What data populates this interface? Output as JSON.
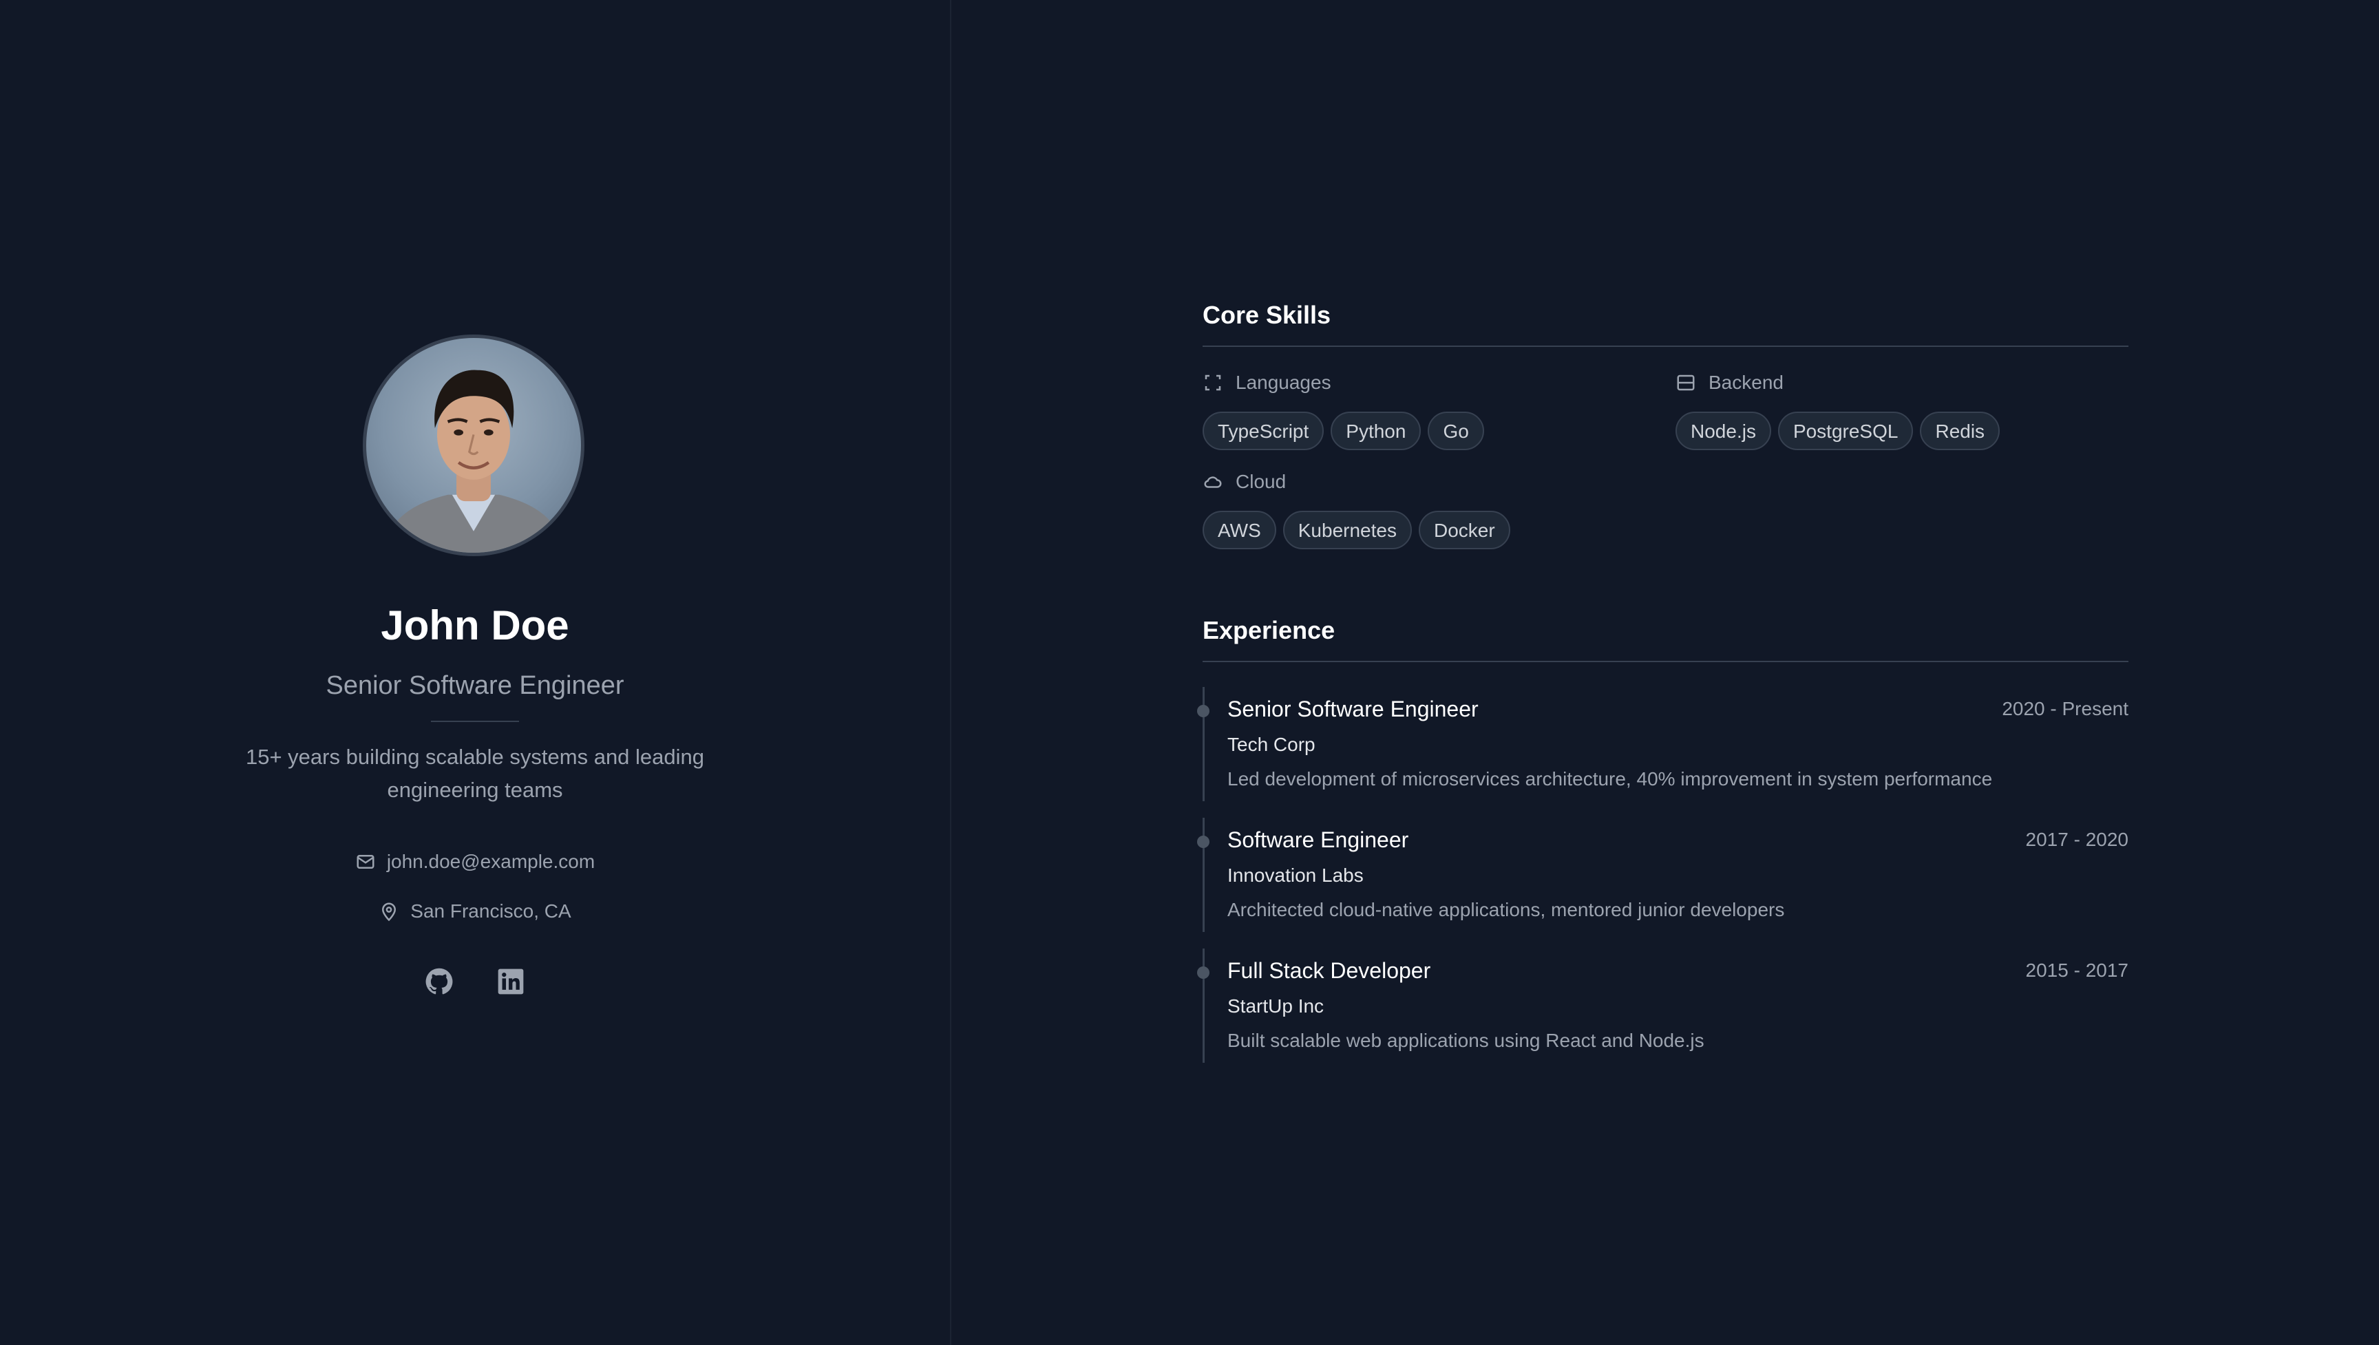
{
  "profile": {
    "name": "John Doe",
    "role": "Senior Software Engineer",
    "bio": "15+ years building scalable systems and leading engineering teams",
    "email": "john.doe@example.com",
    "location": "San Francisco, CA",
    "socials": [
      "github-icon",
      "linkedin-icon"
    ]
  },
  "skills": {
    "title": "Core Skills",
    "groups": [
      {
        "label": "Languages",
        "icon": "code-brackets-icon",
        "items": [
          "TypeScript",
          "Python",
          "Go"
        ]
      },
      {
        "label": "Backend",
        "icon": "server-icon",
        "items": [
          "Node.js",
          "PostgreSQL",
          "Redis"
        ]
      },
      {
        "label": "Cloud",
        "icon": "cloud-icon",
        "items": [
          "AWS",
          "Kubernetes",
          "Docker"
        ]
      }
    ]
  },
  "experience": {
    "title": "Experience",
    "items": [
      {
        "title": "Senior Software Engineer",
        "dates": "2020 - Present",
        "company": "Tech Corp",
        "description": "Led development of microservices architecture, 40% improvement in system performance"
      },
      {
        "title": "Software Engineer",
        "dates": "2017 - 2020",
        "company": "Innovation Labs",
        "description": "Architected cloud-native applications, mentored junior developers"
      },
      {
        "title": "Full Stack Developer",
        "dates": "2015 - 2017",
        "company": "StartUp Inc",
        "description": "Built scalable web applications using React and Node.js"
      }
    ]
  },
  "colors": {
    "background": "#111827",
    "muted_text": "#9ca3af",
    "border": "#374151",
    "tag_bg": "#1f2937"
  }
}
